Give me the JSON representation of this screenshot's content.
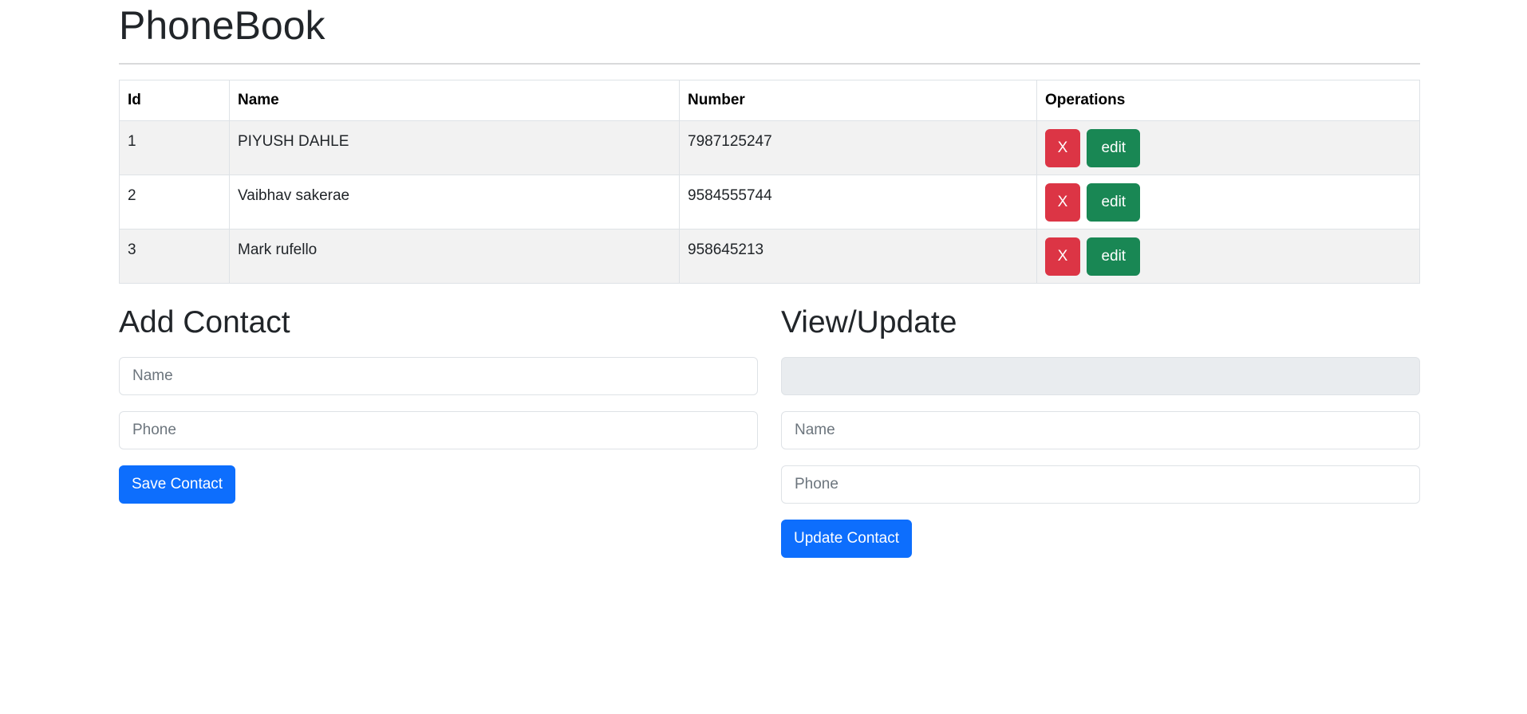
{
  "page": {
    "title": "PhoneBook"
  },
  "table": {
    "headers": {
      "id": "Id",
      "name": "Name",
      "number": "Number",
      "operations": "Operations"
    },
    "rows": [
      {
        "id": "1",
        "name": "PIYUSH DAHLE",
        "number": "7987125247"
      },
      {
        "id": "2",
        "name": "Vaibhav sakerae",
        "number": "9584555744"
      },
      {
        "id": "3",
        "name": "Mark rufello",
        "number": "958645213"
      }
    ],
    "delete_label": "X",
    "edit_label": "edit"
  },
  "add_contact": {
    "title": "Add Contact",
    "name_placeholder": "Name",
    "phone_placeholder": "Phone",
    "name_value": "",
    "phone_value": "",
    "save_label": "Save Contact"
  },
  "view_update": {
    "title": "View/Update",
    "id_value": "",
    "name_placeholder": "Name",
    "phone_placeholder": "Phone",
    "name_value": "",
    "phone_value": "",
    "update_label": "Update Contact"
  },
  "colors": {
    "primary": "#0d6efd",
    "danger": "#dc3545",
    "success": "#198754",
    "stripe": "#f2f2f2"
  }
}
